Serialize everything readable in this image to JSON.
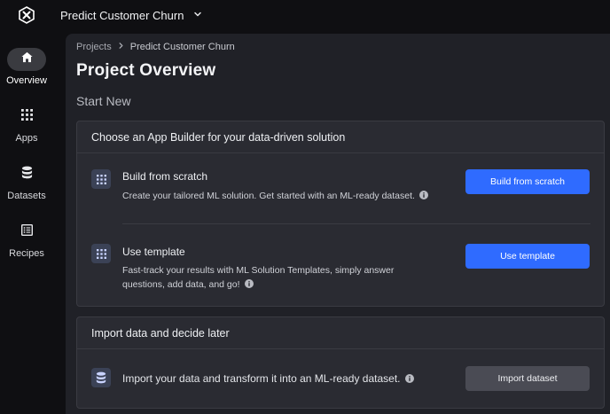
{
  "header": {
    "project_name": "Predict Customer Churn"
  },
  "sidebar": {
    "items": [
      {
        "label": "Overview",
        "icon": "home-icon",
        "active": true
      },
      {
        "label": "Apps",
        "icon": "grid-icon",
        "active": false
      },
      {
        "label": "Datasets",
        "icon": "database-icon",
        "active": false
      },
      {
        "label": "Recipes",
        "icon": "recipe-icon",
        "active": false
      }
    ]
  },
  "breadcrumb": {
    "items": [
      "Projects",
      "Predict Customer Churn"
    ]
  },
  "page": {
    "title": "Project Overview",
    "section_title": "Start New"
  },
  "app_builder_card": {
    "header": "Choose an App Builder for your data-driven solution",
    "rows": [
      {
        "title": "Build from scratch",
        "description": "Create your tailored ML solution. Get started with an ML-ready dataset.",
        "button": "Build from scratch"
      },
      {
        "title": "Use template",
        "description_line1": "Fast-track your results with ML Solution Templates, simply answer",
        "description_line2": "questions, add data, and go!",
        "button": "Use template"
      }
    ]
  },
  "import_card": {
    "header": "Import data and decide later",
    "description": "Import your data and transform it into an ML-ready dataset.",
    "button": "Import dataset"
  },
  "colors": {
    "primary_button": "#2f6bff",
    "secondary_button": "#4a4b54",
    "background": "#0f0f12",
    "panel": "#202127",
    "card": "#2a2b32"
  }
}
